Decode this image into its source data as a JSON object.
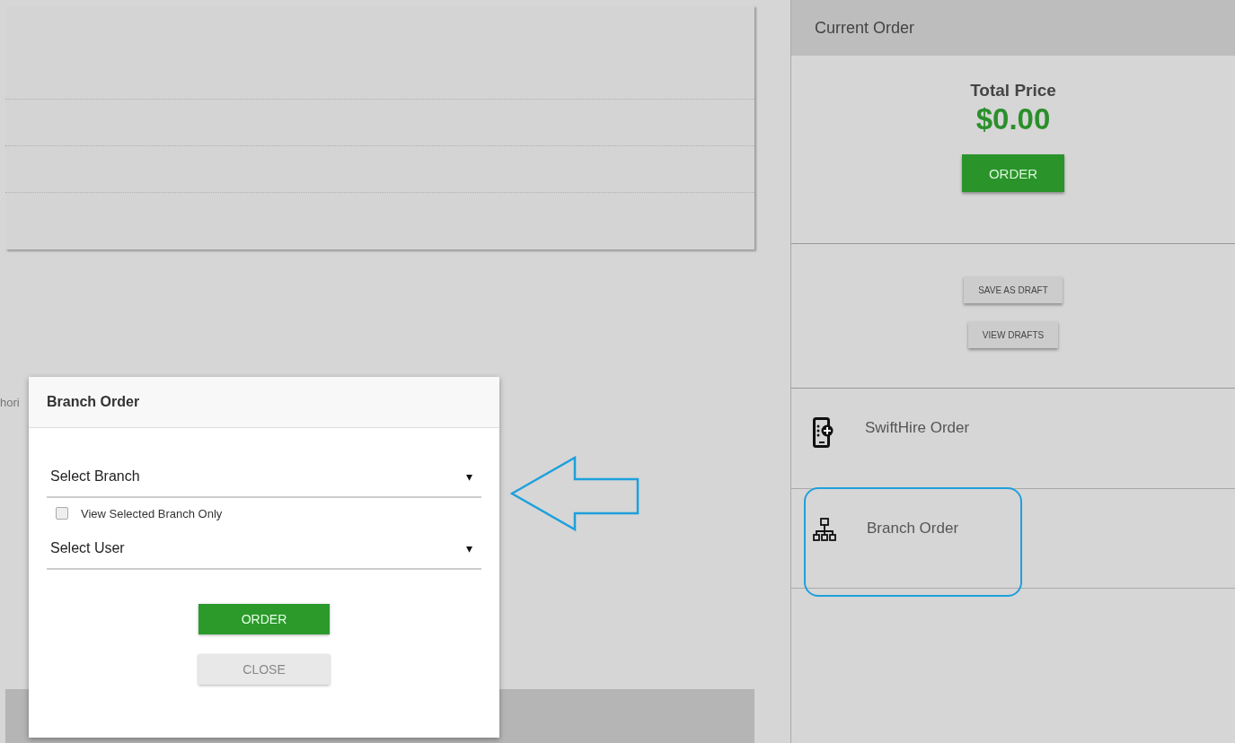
{
  "background": {
    "cut_text": "hori"
  },
  "modal": {
    "title": "Branch Order",
    "selects": [
      {
        "placeholder": "Select Branch"
      },
      {
        "placeholder": "Select User"
      }
    ],
    "checkbox": {
      "label": "View Selected Branch Only",
      "checked": false
    },
    "caret": "▾",
    "buttons": [
      {
        "label": "ORDER",
        "kind": "primary"
      },
      {
        "label": "CLOSE",
        "kind": "secondary"
      }
    ]
  },
  "annotation_arrow": true,
  "panel": {
    "title": "Current Order",
    "total_label": "Total Price",
    "total_value": "$0.00",
    "order_button": "ORDER",
    "draft_buttons": [
      "SAVE AS DRAFT",
      "VIEW DRAFTS"
    ],
    "actions": [
      {
        "label": "SwiftHire Order",
        "kind": "phone",
        "circled": false
      },
      {
        "label": "Branch Order",
        "kind": "branch",
        "circled": true
      }
    ]
  }
}
